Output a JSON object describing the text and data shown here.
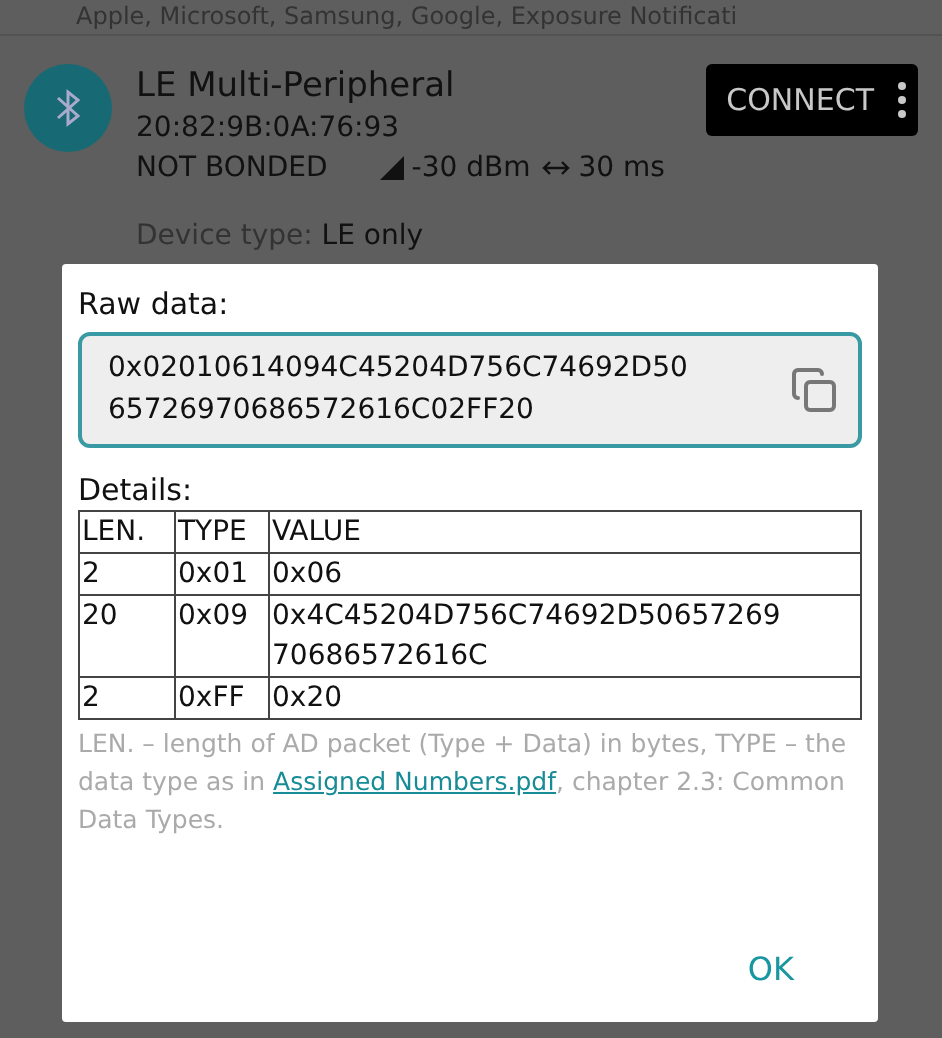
{
  "background": {
    "top_text": "Apple, Microsoft, Samsung, Google, Exposure Notificati",
    "device": {
      "name": "LE Multi-Peripheral",
      "address": "20:82:9B:0A:76:93",
      "bond_state": "NOT BONDED",
      "rssi": "-30 dBm",
      "interval": "30 ms",
      "connect_button": "CONNECT",
      "device_type_label": "Device type:",
      "device_type": "LE only"
    }
  },
  "dialog": {
    "raw_label": "Raw data:",
    "raw_value": "0x02010614094C45204D756C74692D50\n65726970686572616C02FF20",
    "details_label": "Details:",
    "table": {
      "columns": [
        "LEN.",
        "TYPE",
        "VALUE"
      ],
      "rows": [
        [
          "2",
          "0x01",
          "0x06"
        ],
        [
          "20",
          "0x09",
          "0x4C45204D756C74692D50657269\n70686572616C"
        ],
        [
          "2",
          "0xFF",
          "0x20"
        ]
      ]
    },
    "note_before": "LEN. – length of AD packet (Type + Data) in bytes, TYPE – the data type as in ",
    "note_link": "Assigned Numbers.pdf",
    "note_after": ", chapter 2.3: Common Data Types.",
    "ok_button": "OK"
  }
}
